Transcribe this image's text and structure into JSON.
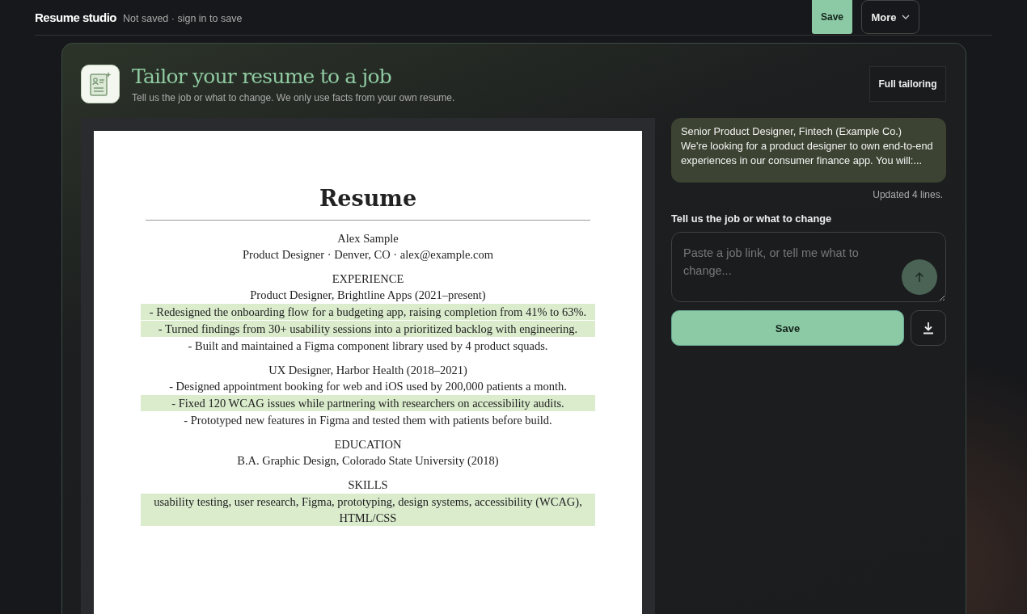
{
  "app": {
    "name": "Resume studio",
    "status": "Not saved · sign in to save"
  },
  "toolbar": {
    "save": "Save",
    "more": "More"
  },
  "header": {
    "title": "Tailor your resume to a job",
    "subtitle": "Tell us the job or what to change. We only use facts from your own resume.",
    "mode_button": "Full tailoring"
  },
  "resume": {
    "title": "Resume",
    "blocks": [
      {
        "kind": "name",
        "text": "Alex Sample",
        "highlighted": false
      },
      {
        "kind": "line",
        "text": "Product Designer · Denver, CO · alex@example.com",
        "highlighted": false
      },
      {
        "kind": "section",
        "text": "EXPERIENCE",
        "highlighted": false
      },
      {
        "kind": "line",
        "text": "Product Designer, Brightline Apps (2021–present)",
        "highlighted": false
      },
      {
        "kind": "line",
        "text": "- Redesigned the onboarding flow for a budgeting app, raising completion from 41% to 63%.",
        "highlighted": true
      },
      {
        "kind": "line",
        "text": "- Turned findings from 30+ usability sessions into a prioritized backlog with engineering.",
        "highlighted": true
      },
      {
        "kind": "line",
        "text": "- Built and maintained a Figma component library used by 4 product squads.",
        "highlighted": false
      },
      {
        "kind": "section",
        "text": "UX Designer, Harbor Health (2018–2021)",
        "highlighted": false
      },
      {
        "kind": "line",
        "text": "- Designed appointment booking for web and iOS used by 200,000 patients a month.",
        "highlighted": false
      },
      {
        "kind": "line",
        "text": "- Fixed 120 WCAG issues while partnering with researchers on accessibility audits.",
        "highlighted": true
      },
      {
        "kind": "line",
        "text": "- Prototyped new features in Figma and tested them with patients before build.",
        "highlighted": false
      },
      {
        "kind": "section",
        "text": "EDUCATION",
        "highlighted": false
      },
      {
        "kind": "line",
        "text": "B.A. Graphic Design, Colorado State University (2018)",
        "highlighted": false
      },
      {
        "kind": "section",
        "text": "SKILLS",
        "highlighted": false
      },
      {
        "kind": "line",
        "text": "usability testing, user research, Figma, prototyping, design systems, accessibility (WCAG), HTML/CSS",
        "highlighted": true
      }
    ]
  },
  "chat": {
    "message": "Senior Product Designer, Fintech (Example Co.)\nWe're looking for a product designer to own end-to-end experiences in our consumer finance app. You will:...",
    "note": "Updated 4 lines."
  },
  "composer": {
    "label": "Tell us the job or what to change",
    "placeholder": "Paste a job link, or tell me what to change...",
    "save": "Save"
  }
}
